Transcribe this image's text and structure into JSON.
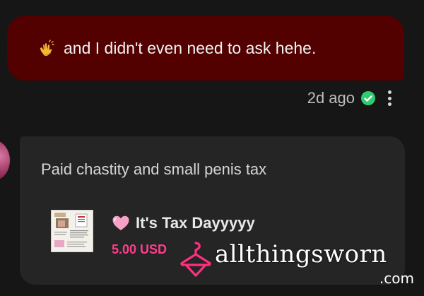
{
  "sent_message": {
    "emoji_icon": "clapping-hands-icon",
    "text": "and I didn't even need to ask hehe."
  },
  "meta": {
    "time": "2d ago",
    "status_icon": "check-circle-icon",
    "status_color": "#2ecc71",
    "more_icon": "more-vertical-icon"
  },
  "received_message": {
    "text": "Paid chastity and small penis tax",
    "product": {
      "heart_icon": "pink-heart-icon",
      "name": "It's Tax Dayyyyy",
      "price": "5.00 USD",
      "price_color": "#ff3d8b"
    }
  },
  "watermark": {
    "text": "allthingsworn",
    "suffix": ".com",
    "icon": "hanger-icon",
    "icon_color": "#ff2e7e"
  },
  "colors": {
    "background": "#161616",
    "sent_bubble": "#520000",
    "received_bubble": "#252525"
  }
}
